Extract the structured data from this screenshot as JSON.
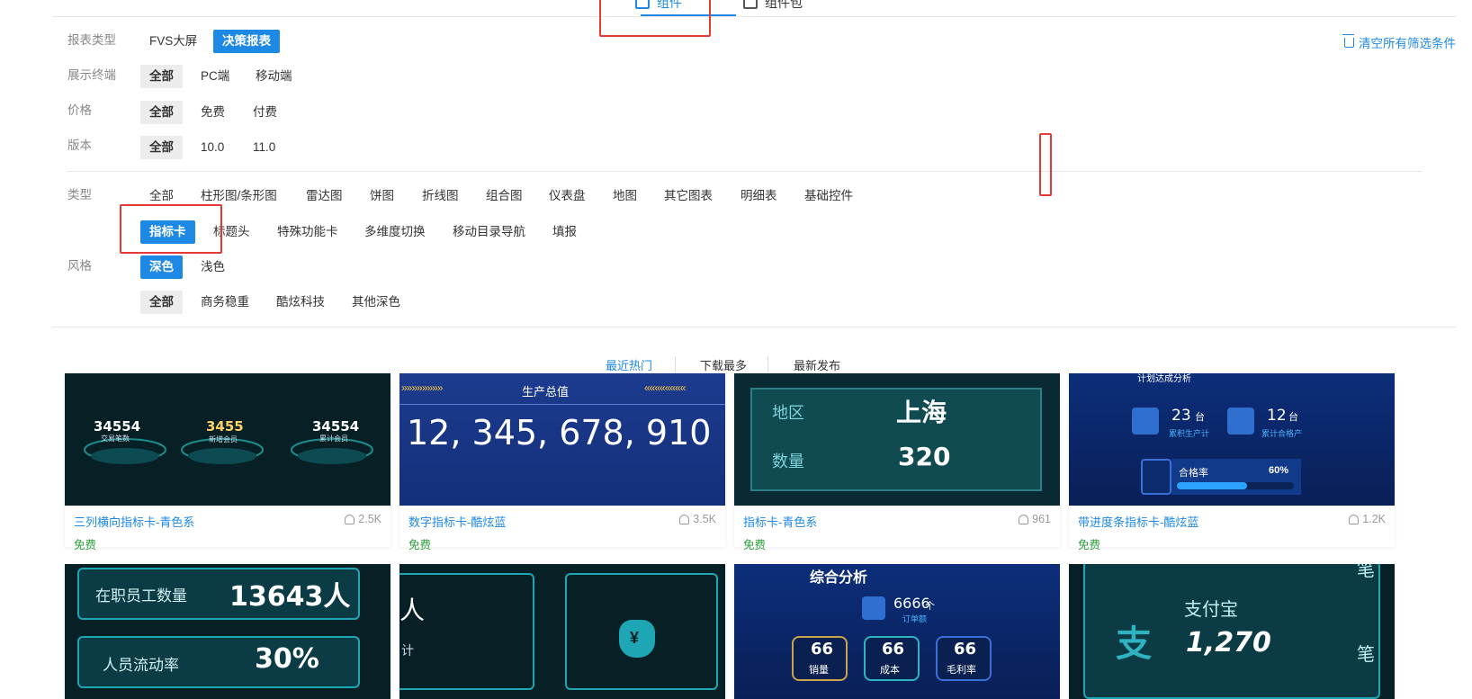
{
  "top_tabs": [
    {
      "label": "组件"
    },
    {
      "label": "组件包"
    }
  ],
  "clear_filters": "清空所有筛选条件",
  "filters": {
    "report_type": {
      "label": "报表类型",
      "options": [
        "FVS大屏",
        "决策报表"
      ]
    },
    "terminal": {
      "label": "展示终端",
      "options": [
        "全部",
        "PC端",
        "移动端"
      ]
    },
    "price": {
      "label": "价格",
      "options": [
        "全部",
        "免费",
        "付费"
      ]
    },
    "version": {
      "label": "版本",
      "options": [
        "全部",
        "10.0",
        "11.0"
      ]
    },
    "type": {
      "label": "类型",
      "options": [
        "全部",
        "柱形图/条形图",
        "雷达图",
        "饼图",
        "折线图",
        "组合图",
        "仪表盘",
        "地图",
        "其它图表",
        "明细表",
        "基础控件",
        "指标卡",
        "标题头",
        "特殊功能卡",
        "多维度切换",
        "移动目录导航",
        "填报"
      ]
    },
    "style": {
      "label": "风格",
      "options": [
        "深色",
        "浅色"
      ],
      "sub_options": [
        "全部",
        "商务稳重",
        "酷炫科技",
        "其他深色"
      ]
    }
  },
  "sort": [
    "最近热门",
    "下载最多",
    "最新发布"
  ],
  "cards": [
    {
      "title": "三列横向指标卡-青色系",
      "downloads": "2.5K",
      "price": "免费",
      "preview": {
        "v1": "34554",
        "l1": "交易笔数",
        "v2": "3455",
        "l2": "新增会员",
        "v3": "34554",
        "l3": "累计会员"
      }
    },
    {
      "title": "数字指标卡-酷炫蓝",
      "downloads": "3.5K",
      "price": "免费",
      "preview": {
        "header": "生产总值",
        "value": "12, 345, 678, 910",
        "left_arrows": "»»»»»»»»",
        "right_arrows": "««««««««"
      }
    },
    {
      "title": "指标卡-青色系",
      "downloads": "961",
      "price": "免费",
      "preview": {
        "k1": "地区",
        "v1": "上海",
        "k2": "数量",
        "v2": "320"
      }
    },
    {
      "title": "带进度条指标卡-酷炫蓝",
      "downloads": "1.2K",
      "price": "免费",
      "preview": {
        "header": "计划达成分析",
        "v1": "23",
        "u1": "台",
        "l1": "累积生产计",
        "v2": "12",
        "u2": "台",
        "l2": "累计合格产",
        "bar_label": "合格率",
        "bar_value": "60%",
        "progress": 0.6
      }
    },
    {
      "title": "",
      "preview": {
        "r1": "在职员工数量",
        "v1": "13643人",
        "r2": "人员流动率",
        "v2": "30%"
      }
    },
    {
      "title": "",
      "preview": {
        "l1": "人",
        "l2": "计",
        "money": "¥"
      }
    },
    {
      "title": "",
      "preview": {
        "header": "综合分析",
        "v": "6666",
        "u": "个",
        "sub": "订单额",
        "b1": "66",
        "l1": "销量",
        "b2": "66",
        "l2": "成本",
        "b3": "66",
        "l3": "毛利率"
      }
    },
    {
      "title": "",
      "preview": {
        "name": "支付宝",
        "value": "1,270",
        "glyph": "支",
        "e1": "笔",
        "e2": "笔"
      }
    }
  ]
}
